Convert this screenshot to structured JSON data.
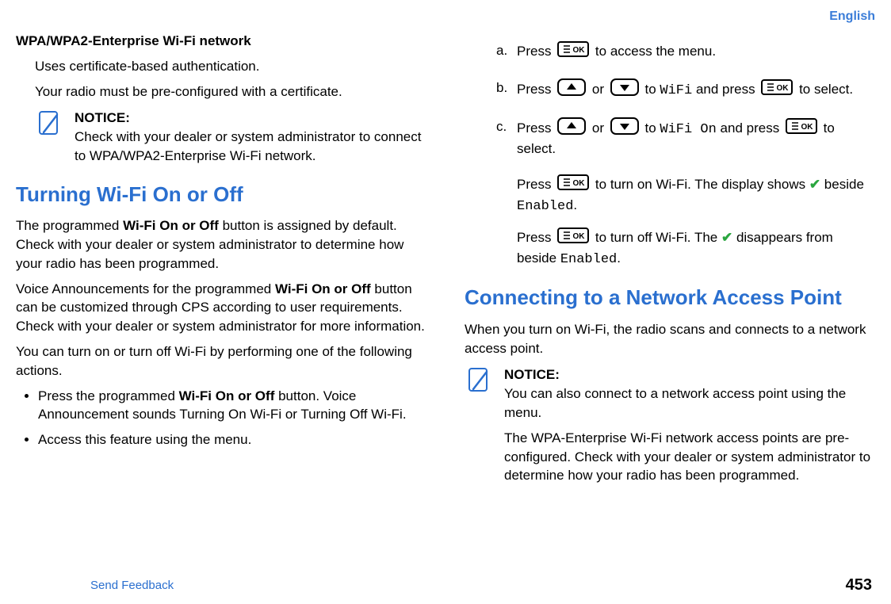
{
  "lang": "English",
  "left": {
    "wpa_title": "WPA/WPA2-Enterprise Wi-Fi network",
    "wpa_line1": "Uses certificate-based authentication.",
    "wpa_line2": "Your radio must be pre-configured with a certificate.",
    "notice_label": "NOTICE:",
    "notice_text": "Check with your dealer or system administrator to connect to WPA/WPA2-Enterprise Wi-Fi network.",
    "h2_turning": "Turning Wi-Fi On or Off",
    "p1_a": "The programmed ",
    "p1_bold": "Wi-Fi On or Off",
    "p1_b": " button is assigned by default. Check with your dealer or system administrator to determine how your radio has been programmed.",
    "p2_a": "Voice Announcements for the programmed ",
    "p2_bold": "Wi-Fi On or Off",
    "p2_b": " button can be customized through CPS according to user requirements. Check with your dealer or system administrator for more information.",
    "p3": "You can turn on or turn off Wi-Fi by performing one of the following actions.",
    "bullet1_a": "Press the programmed ",
    "bullet1_bold": "Wi-Fi On or Off",
    "bullet1_b": " button. Voice Announcement sounds Turning On Wi-Fi or Turning Off Wi-Fi.",
    "bullet2": "Access this feature using the menu."
  },
  "right": {
    "step_a_pre": "Press ",
    "step_a_post": " to access the menu.",
    "step_b_pre": "Press ",
    "step_b_mid1": " or ",
    "step_b_mid2": " to ",
    "step_b_wifi": "WiFi",
    "step_b_mid3": " and press ",
    "step_b_post": " to select.",
    "step_c_pre": "Press ",
    "step_c_mid1": " or ",
    "step_c_mid2": " to ",
    "step_c_wifi_on": "WiFi On",
    "step_c_mid3": " and press ",
    "step_c_post": " to select.",
    "turnon_pre": "Press ",
    "turnon_mid": " to turn on Wi-Fi. The display shows ",
    "turnon_post": " beside ",
    "enabled": "Enabled",
    "period": ".",
    "turnoff_pre": "Press ",
    "turnoff_mid": " to turn off Wi-Fi. The ",
    "turnoff_post": " disappears from beside ",
    "h2_connecting": "Connecting to a Network Access Point",
    "connecting_p1": "When you turn on Wi-Fi, the radio scans and connects to a network access point.",
    "notice_label": "NOTICE:",
    "notice_line1": "You can also connect to a network access point using the menu.",
    "notice_line2": "The WPA-Enterprise Wi-Fi network access points are pre-configured. Check with your dealer or system administrator to determine how your radio has been programmed."
  },
  "footer": {
    "link": "Send Feedback",
    "pagenum": "453"
  },
  "letters": {
    "a": "a.",
    "b": "b.",
    "c": "c."
  }
}
